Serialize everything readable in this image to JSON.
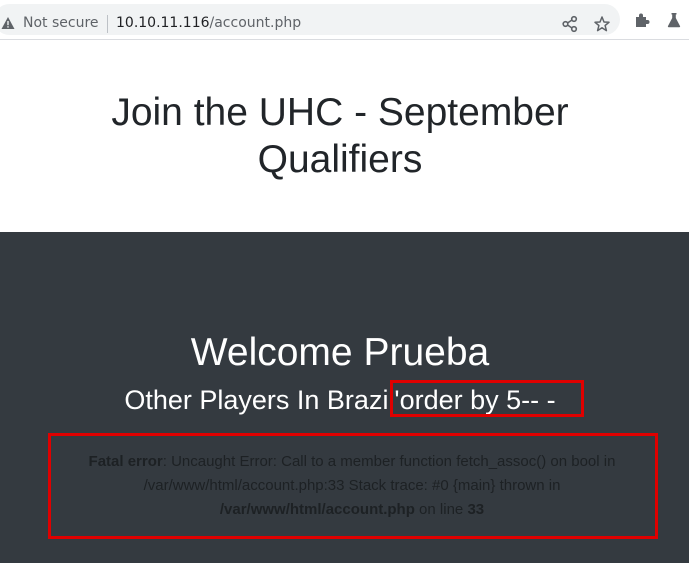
{
  "browser": {
    "security_label": "Not secure",
    "url_host": "10.10.11.116",
    "url_path": "/account.php",
    "icons": [
      "warning-icon",
      "share-icon",
      "star-icon",
      "extensions-icon",
      "lab-flask-icon"
    ]
  },
  "hero": {
    "title": "Join the UHC - September Qualifiers"
  },
  "main": {
    "welcome": "Welcome Prueba",
    "players_prefix": "Other Players In Brazi",
    "players_injection": "l'order by 5-- -",
    "error": {
      "label": "Fatal error",
      "message": ": Uncaught Error: Call to a member function fetch_assoc() on bool in /var/www/html/account.php:33 Stack trace: #0 {main} thrown in ",
      "file": "/var/www/html/account.php",
      "on_line": " on line ",
      "line": "33"
    }
  },
  "colors": {
    "dark_bg": "#343a40",
    "annotation_red": "#e00000"
  }
}
